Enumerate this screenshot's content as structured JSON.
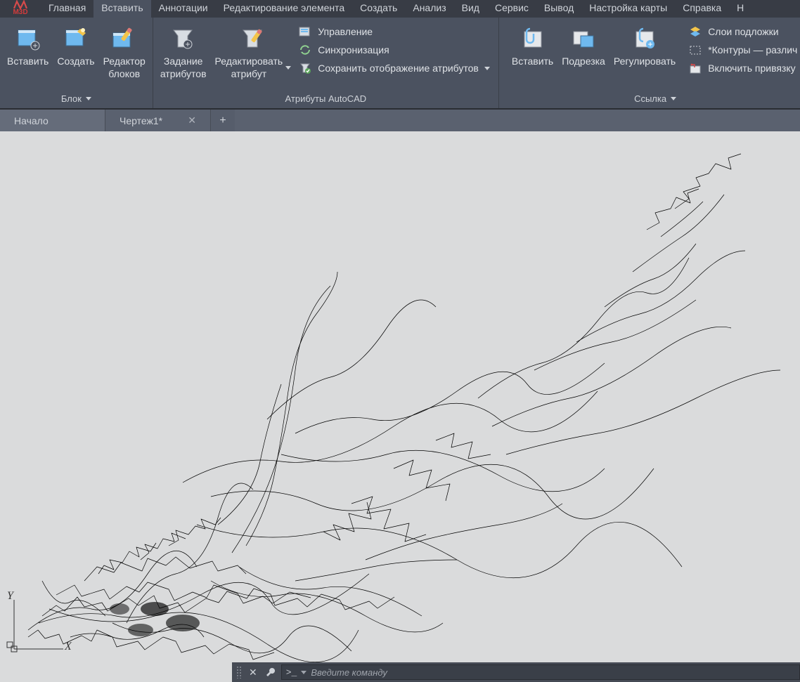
{
  "app": {
    "logo_text": "M3D"
  },
  "menu": {
    "items": [
      "Главная",
      "Вставить",
      "Аннотации",
      "Редактирование элемента",
      "Создать",
      "Анализ",
      "Вид",
      "Сервис",
      "Вывод",
      "Настройка карты",
      "Справка",
      "Н"
    ],
    "active_index": 1
  },
  "ribbon": {
    "panels": [
      {
        "title": "Блок",
        "title_has_dropdown": true,
        "big_buttons": [
          {
            "label": "Вставить",
            "icon": "insert-block-icon"
          },
          {
            "label": "Создать",
            "icon": "create-block-icon"
          },
          {
            "label": "Редактор\nблоков",
            "icon": "block-editor-icon"
          }
        ]
      },
      {
        "title": "Атрибуты AutoCAD",
        "title_has_dropdown": false,
        "big_buttons": [
          {
            "label": "Задание\nатрибутов",
            "icon": "define-attr-icon"
          },
          {
            "label": "Редактировать\nатрибут",
            "icon": "edit-attr-icon",
            "dropdown": true
          }
        ],
        "small_buttons": [
          {
            "label": "Управление",
            "icon": "manage-icon"
          },
          {
            "label": "Синхронизация",
            "icon": "sync-icon"
          },
          {
            "label": "Сохранить отображение атрибутов",
            "icon": "save-attr-display-icon",
            "dropdown": true
          }
        ]
      },
      {
        "spacer": true
      },
      {
        "title": "Ссылка",
        "title_has_dropdown": true,
        "big_buttons": [
          {
            "label": "Вставить",
            "icon": "attach-icon"
          },
          {
            "label": "Подрезка",
            "icon": "clip-icon"
          },
          {
            "label": "Регулировать",
            "icon": "adjust-icon"
          }
        ],
        "small_buttons": [
          {
            "label": "Слои подложки",
            "icon": "underlay-layers-icon"
          },
          {
            "label": "*Контуры — различ",
            "icon": "frames-vary-icon"
          },
          {
            "label": "Включить привязку",
            "icon": "snap-to-underlay-icon"
          }
        ]
      }
    ]
  },
  "tabs": {
    "items": [
      {
        "label": "Начало",
        "active": false,
        "closable": false
      },
      {
        "label": "Чертеж1*",
        "active": true,
        "closable": true
      }
    ],
    "new_tab_glyph": "+"
  },
  "ucs": {
    "x_label": "X",
    "y_label": "Y"
  },
  "commandbar": {
    "placeholder": "Введите команду",
    "prompt_glyph": ">_"
  },
  "colors": {
    "menubar_bg": "#383c45",
    "ribbon_bg": "#4b5260",
    "canvas_bg": "#dadbdc",
    "accent_blue": "#6fb9ef",
    "accent_yellow": "#f3c44a"
  }
}
